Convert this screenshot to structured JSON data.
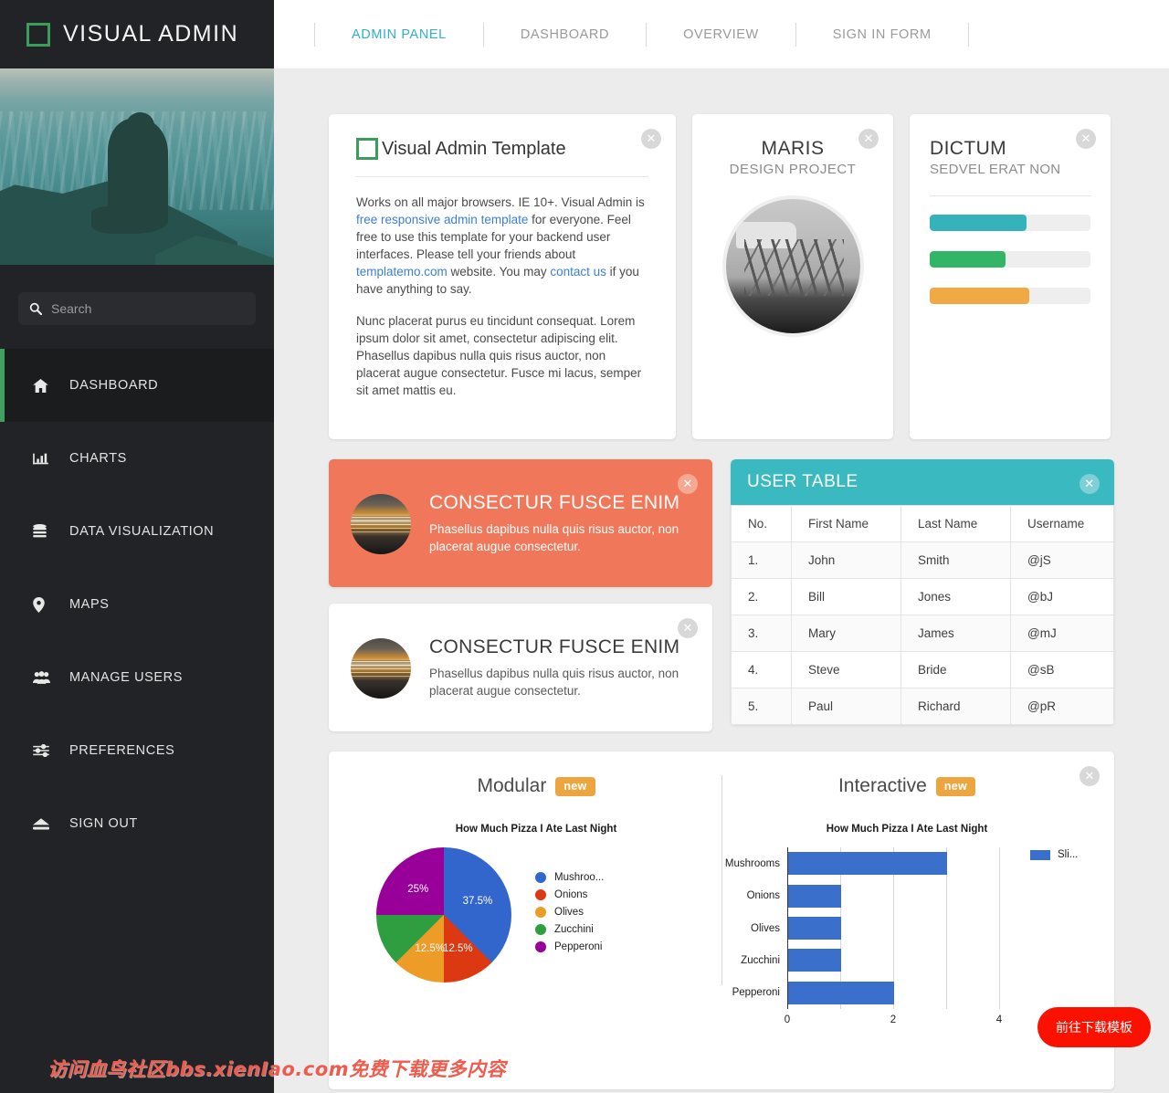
{
  "brand": {
    "title": "VISUAL ADMIN",
    "logo_icon": "square-outline-icon",
    "accent": "#3a9e5a"
  },
  "search": {
    "placeholder": "Search",
    "value": "",
    "icon": "search-icon"
  },
  "sidebar": {
    "items": [
      {
        "label": "DASHBOARD",
        "icon": "home-icon",
        "active": true
      },
      {
        "label": "CHARTS",
        "icon": "bar-chart-icon",
        "active": false
      },
      {
        "label": "DATA VISUALIZATION",
        "icon": "database-icon",
        "active": false
      },
      {
        "label": "MAPS",
        "icon": "map-pin-icon",
        "active": false
      },
      {
        "label": "MANAGE USERS",
        "icon": "users-icon",
        "active": false
      },
      {
        "label": "PREFERENCES",
        "icon": "sliders-icon",
        "active": false
      },
      {
        "label": "SIGN OUT",
        "icon": "eject-icon",
        "active": false
      }
    ]
  },
  "topnav": {
    "items": [
      {
        "label": "ADMIN PANEL",
        "active": true
      },
      {
        "label": "DASHBOARD",
        "active": false
      },
      {
        "label": "OVERVIEW",
        "active": false
      },
      {
        "label": "SIGN IN FORM",
        "active": false
      }
    ],
    "active_color": "#31b0c6"
  },
  "intro_card": {
    "title": "Visual Admin Template",
    "close_icon": "close-icon",
    "p1_a": "Works on all major browsers. IE 10+. Visual Admin is ",
    "link1": "free responsive admin template",
    "p1_b": " for everyone. Feel free to use this template for your backend user interfaces. Please tell your friends about ",
    "link2": "templatemo.com",
    "p1_c": " website. You may ",
    "link3": "contact us",
    "p1_d": " if you have anything to say.",
    "p2": "Nunc placerat purus eu tincidunt consequat. Lorem ipsum dolor sit amet, consectetur adipiscing elit. Phasellus dapibus nulla quis risus auctor, non placerat augue consectetur. Fusce mi lacus, semper sit amet mattis eu."
  },
  "maris_card": {
    "title": "MARIS",
    "subtitle": "DESIGN PROJECT",
    "close_icon": "close-icon",
    "photo_alt": "bicycle-racks-photo"
  },
  "dictum_card": {
    "title": "DICTUM",
    "subtitle": "SEDVEL ERAT NON",
    "close_icon": "close-icon",
    "bars": [
      {
        "percent": 60,
        "color": "#35b3bb"
      },
      {
        "percent": 47,
        "color": "#33b567"
      },
      {
        "percent": 62,
        "color": "#f0a943"
      }
    ]
  },
  "promos": [
    {
      "title": "CONSECTUR FUSCE ENIM",
      "text": "Phasellus dapibus nulla quis risus auctor, non placerat augue consectetur.",
      "style": "orange",
      "bg": "#f0775a",
      "close_icon": "close-icon",
      "thumb_alt": "sunset-thumbnail"
    },
    {
      "title": "CONSECTUR FUSCE ENIM",
      "text": "Phasellus dapibus nulla quis risus auctor, non placerat augue consectetur.",
      "style": "white",
      "bg": "#ffffff",
      "close_icon": "close-icon",
      "thumb_alt": "sunset-thumbnail"
    }
  ],
  "user_table": {
    "title": "USER TABLE",
    "header_color": "#3bb9c1",
    "close_icon": "close-icon",
    "columns": [
      "No.",
      "First Name",
      "Last Name",
      "Username"
    ],
    "rows": [
      [
        "1.",
        "John",
        "Smith",
        "@jS"
      ],
      [
        "2.",
        "Bill",
        "Jones",
        "@bJ"
      ],
      [
        "3.",
        "Mary",
        "James",
        "@mJ"
      ],
      [
        "4.",
        "Steve",
        "Bride",
        "@sB"
      ],
      [
        "5.",
        "Paul",
        "Richard",
        "@pR"
      ]
    ]
  },
  "charts_card": {
    "close_icon": "close-icon",
    "left_heading": "Modular",
    "left_badge": "new",
    "right_heading": "Interactive",
    "right_badge": "new"
  },
  "chart_data": [
    {
      "type": "pie",
      "title": "How Much Pizza I Ate Last Night",
      "categories": [
        "Mushrooms",
        "Onions",
        "Olives",
        "Zucchini",
        "Pepperoni"
      ],
      "values": [
        37.5,
        12.5,
        12.5,
        12.5,
        25
      ],
      "value_labels": [
        "37.5%",
        "12.5%",
        "12.5%",
        "",
        "25%"
      ],
      "colors": [
        "#3366cc",
        "#dc3912",
        "#ed9c28",
        "#2f9e41",
        "#990099"
      ],
      "legend": [
        "Mushroo...",
        "Onions",
        "Olives",
        "Zucchini",
        "Pepperoni"
      ],
      "legend_position": "right"
    },
    {
      "type": "bar",
      "orientation": "horizontal",
      "title": "How Much Pizza I Ate Last Night",
      "categories": [
        "Mushrooms",
        "Onions",
        "Olives",
        "Zucchini",
        "Pepperoni"
      ],
      "values": [
        3,
        1,
        1,
        1,
        2
      ],
      "series_name": "Sli...",
      "color": "#3a6fcc",
      "xlim": [
        0,
        4
      ],
      "xticks": [
        "0",
        "2",
        "4"
      ],
      "gridlines": [
        0,
        1,
        2,
        3,
        4
      ],
      "legend_position": "right"
    }
  ],
  "overlay": {
    "download_button": "前往下载模板",
    "download_color": "#fb1100",
    "watermark": "访问血鸟社区bbs.xienIao.com免费下载更多内容"
  }
}
